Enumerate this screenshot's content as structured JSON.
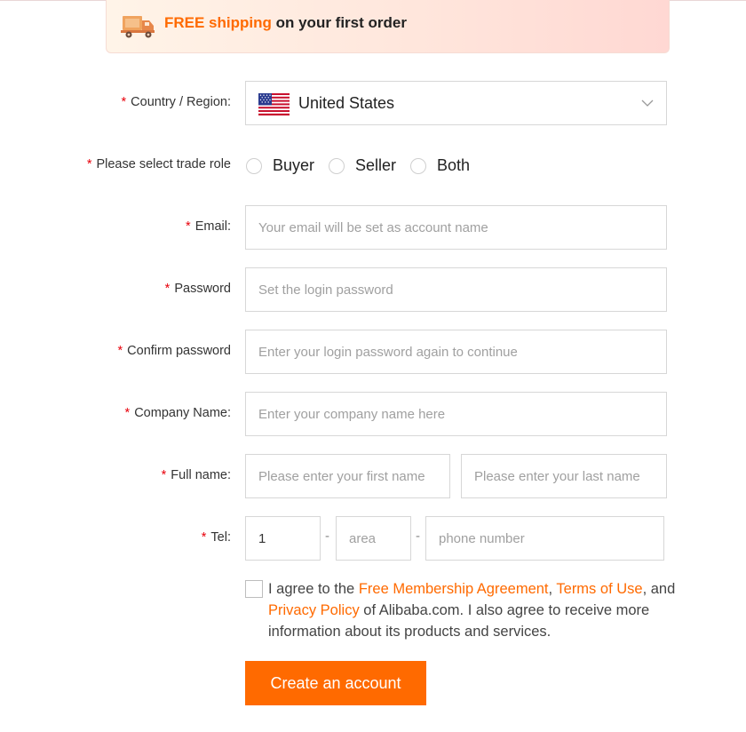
{
  "banner": {
    "highlight": "FREE shipping",
    "rest": " on your first order",
    "icon": "delivery-truck-icon"
  },
  "required_mark": "*",
  "country": {
    "label": "Country / Region:",
    "value": "United States",
    "flag_icon": "us-flag-icon"
  },
  "trade_role": {
    "label": "Please select trade role",
    "options": [
      "Buyer",
      "Seller",
      "Both"
    ]
  },
  "email": {
    "label": "Email:",
    "placeholder": "Your email will be set as account name"
  },
  "password": {
    "label": "Password",
    "placeholder": "Set the login password"
  },
  "confirm_password": {
    "label": "Confirm password",
    "placeholder": "Enter your login password again to continue"
  },
  "company": {
    "label": "Company Name:",
    "placeholder": "Enter your company name here"
  },
  "full_name": {
    "label": "Full name:",
    "first_placeholder": "Please enter your first name",
    "last_placeholder": "Please enter your last name"
  },
  "tel": {
    "label": "Tel:",
    "country_code": "1",
    "area_placeholder": "area",
    "phone_placeholder": "phone number",
    "separator": "-"
  },
  "agreement": {
    "prefix": "I agree to the ",
    "link1": "Free Membership Agreement",
    "sep1": ", ",
    "link2": "Terms of Use",
    "sep2": ", and ",
    "link3": "Privacy Policy",
    "suffix": " of Alibaba.com. I also agree to receive more information about its products and services."
  },
  "submit_label": "Create an account",
  "colors": {
    "accent": "#ff6a00",
    "required": "#e8000b"
  }
}
